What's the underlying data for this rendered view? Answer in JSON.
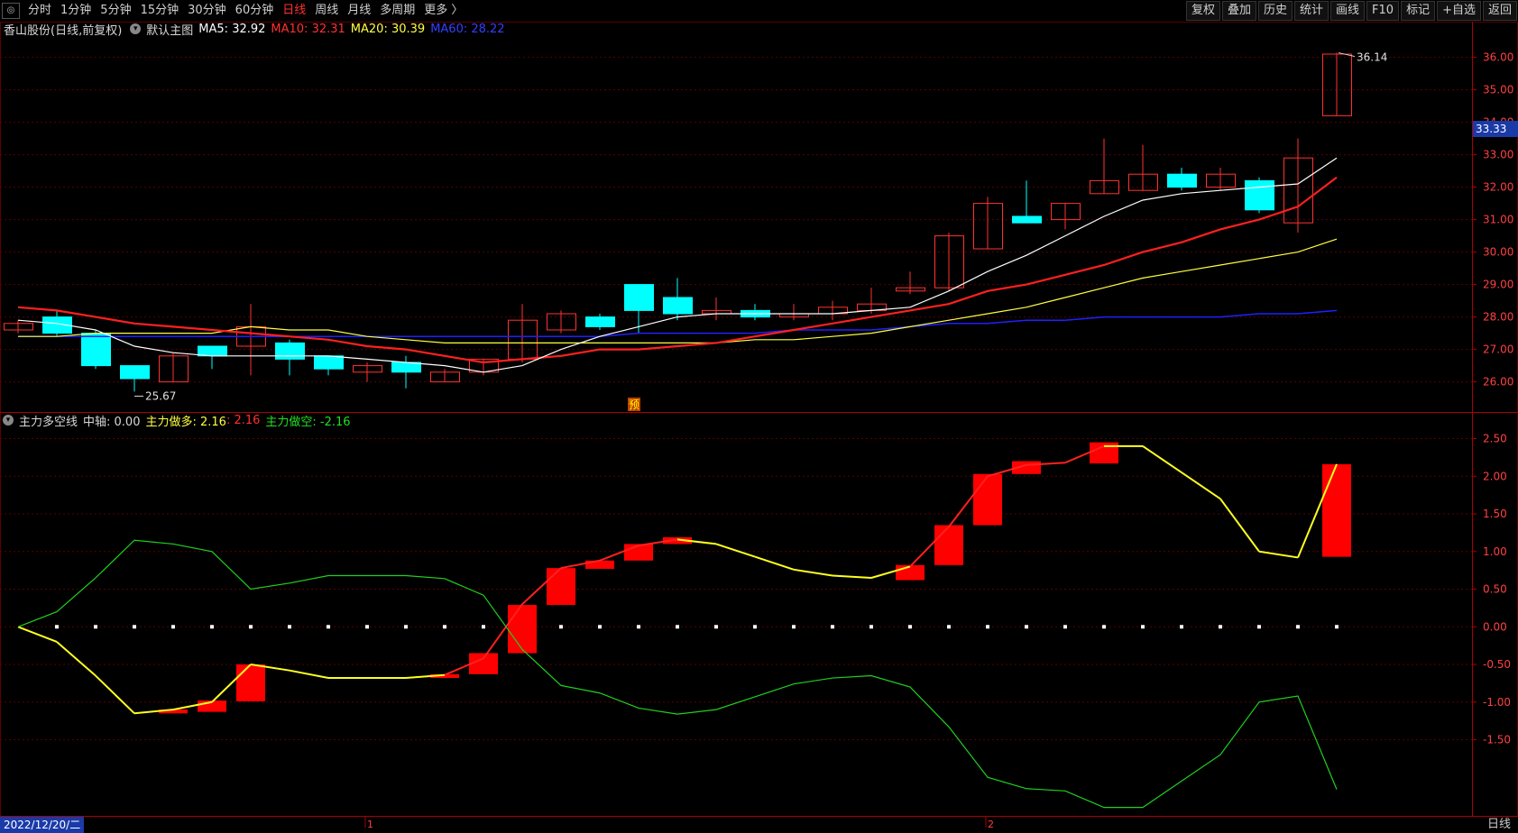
{
  "toolbar": {
    "periods": [
      {
        "label": "分时",
        "active": false
      },
      {
        "label": "1分钟",
        "active": false
      },
      {
        "label": "5分钟",
        "active": false
      },
      {
        "label": "15分钟",
        "active": false
      },
      {
        "label": "30分钟",
        "active": false
      },
      {
        "label": "60分钟",
        "active": false
      },
      {
        "label": "日线",
        "active": true
      },
      {
        "label": "周线",
        "active": false
      },
      {
        "label": "月线",
        "active": false
      },
      {
        "label": "多周期",
        "active": false
      },
      {
        "label": "更多 〉",
        "active": false
      }
    ],
    "right_buttons": [
      "复权",
      "叠加",
      "历史",
      "统计",
      "画线",
      "F10",
      "标记",
      "+自选",
      "返回"
    ]
  },
  "main_legend": {
    "stock": "香山股份(日线,前复权)",
    "chart_name": "默认主图",
    "ma5": "MA5: 32.92",
    "ma10": "MA10: 32.31",
    "ma20": "MA20: 30.39",
    "ma60": "MA60: 28.22"
  },
  "sub_legend": {
    "indicator": "主力多空线",
    "axis": "中轴: 0.00",
    "long_label": "主力做多: 2.16",
    "long_value": ": 2.16",
    "short_label": "主力做空: -2.16"
  },
  "annotations": {
    "high_label": "36.14",
    "low_label": "25.67",
    "pre_badge": "预",
    "current_price": "33.33",
    "month_marks": [
      "1",
      "2"
    ]
  },
  "status": {
    "date": "2022/12/20/二",
    "period": "日线"
  },
  "colors": {
    "up": "#ff3232",
    "down": "#00ffff",
    "ma5": "#ffffff",
    "ma10": "#ff2020",
    "ma20": "#ffff40",
    "ma60": "#2020ff",
    "grid": "#5a0000"
  },
  "chart_data": {
    "type": "candlestick",
    "price_axis": {
      "ticks": [
        26.0,
        27.0,
        28.0,
        29.0,
        30.0,
        31.0,
        32.0,
        33.0,
        34.0,
        35.0,
        36.0
      ],
      "ylim": [
        25.1,
        36.6
      ]
    },
    "candles": [
      {
        "o": 27.6,
        "h": 27.9,
        "l": 27.5,
        "c": 27.8
      },
      {
        "o": 28.0,
        "h": 28.2,
        "l": 27.4,
        "c": 27.5
      },
      {
        "o": 27.5,
        "h": 27.6,
        "l": 26.4,
        "c": 26.5
      },
      {
        "o": 26.5,
        "h": 26.5,
        "l": 25.7,
        "c": 26.1
      },
      {
        "o": 26.0,
        "h": 26.9,
        "l": 26.0,
        "c": 26.8
      },
      {
        "o": 27.1,
        "h": 27.1,
        "l": 26.4,
        "c": 26.8
      },
      {
        "o": 27.1,
        "h": 28.4,
        "l": 26.2,
        "c": 27.7
      },
      {
        "o": 27.2,
        "h": 27.3,
        "l": 26.2,
        "c": 26.7
      },
      {
        "o": 26.8,
        "h": 26.8,
        "l": 26.2,
        "c": 26.4
      },
      {
        "o": 26.3,
        "h": 26.6,
        "l": 26.0,
        "c": 26.5
      },
      {
        "o": 26.6,
        "h": 26.8,
        "l": 25.8,
        "c": 26.3
      },
      {
        "o": 26.0,
        "h": 26.4,
        "l": 26.0,
        "c": 26.3
      },
      {
        "o": 26.3,
        "h": 26.7,
        "l": 26.2,
        "c": 26.7
      },
      {
        "o": 26.7,
        "h": 28.4,
        "l": 26.6,
        "c": 27.9
      },
      {
        "o": 27.6,
        "h": 28.2,
        "l": 27.5,
        "c": 28.1
      },
      {
        "o": 28.0,
        "h": 28.1,
        "l": 27.6,
        "c": 27.7
      },
      {
        "o": 29.0,
        "h": 29.0,
        "l": 27.5,
        "c": 28.2
      },
      {
        "o": 28.6,
        "h": 29.2,
        "l": 27.9,
        "c": 28.1
      },
      {
        "o": 28.1,
        "h": 28.6,
        "l": 27.9,
        "c": 28.2
      },
      {
        "o": 28.2,
        "h": 28.4,
        "l": 27.9,
        "c": 28.0
      },
      {
        "o": 28.0,
        "h": 28.4,
        "l": 27.9,
        "c": 28.1
      },
      {
        "o": 28.1,
        "h": 28.5,
        "l": 27.9,
        "c": 28.3
      },
      {
        "o": 28.2,
        "h": 28.9,
        "l": 28.1,
        "c": 28.4
      },
      {
        "o": 28.8,
        "h": 29.4,
        "l": 28.7,
        "c": 28.9
      },
      {
        "o": 28.9,
        "h": 30.6,
        "l": 28.8,
        "c": 30.5
      },
      {
        "o": 30.1,
        "h": 31.7,
        "l": 30.1,
        "c": 31.5
      },
      {
        "o": 31.1,
        "h": 32.2,
        "l": 30.9,
        "c": 30.9
      },
      {
        "o": 31.0,
        "h": 31.5,
        "l": 30.7,
        "c": 31.5
      },
      {
        "o": 31.8,
        "h": 33.5,
        "l": 31.8,
        "c": 32.2
      },
      {
        "o": 31.9,
        "h": 33.3,
        "l": 31.9,
        "c": 32.4
      },
      {
        "o": 32.4,
        "h": 32.6,
        "l": 31.9,
        "c": 32.0
      },
      {
        "o": 32.0,
        "h": 32.6,
        "l": 31.9,
        "c": 32.4
      },
      {
        "o": 32.2,
        "h": 32.3,
        "l": 31.2,
        "c": 31.3
      },
      {
        "o": 30.9,
        "h": 33.5,
        "l": 30.6,
        "c": 32.9
      },
      {
        "o": 34.2,
        "h": 36.14,
        "l": 34.2,
        "c": 36.1
      }
    ],
    "ma5": [
      27.9,
      27.8,
      27.6,
      27.1,
      26.9,
      26.8,
      26.8,
      26.8,
      26.8,
      26.7,
      26.6,
      26.5,
      26.3,
      26.5,
      27.0,
      27.4,
      27.7,
      28.0,
      28.1,
      28.1,
      28.1,
      28.1,
      28.2,
      28.3,
      28.8,
      29.4,
      29.9,
      30.5,
      31.1,
      31.6,
      31.8,
      31.9,
      32.0,
      32.1,
      32.9
    ],
    "ma10": [
      28.3,
      28.2,
      28.0,
      27.8,
      27.7,
      27.6,
      27.5,
      27.4,
      27.3,
      27.1,
      27.0,
      26.8,
      26.6,
      26.7,
      26.8,
      27.0,
      27.0,
      27.1,
      27.2,
      27.4,
      27.6,
      27.8,
      28.0,
      28.2,
      28.4,
      28.8,
      29.0,
      29.3,
      29.6,
      30.0,
      30.3,
      30.7,
      31.0,
      31.4,
      32.3
    ],
    "ma20": [
      27.4,
      27.4,
      27.5,
      27.5,
      27.5,
      27.5,
      27.7,
      27.6,
      27.6,
      27.4,
      27.3,
      27.2,
      27.2,
      27.2,
      27.2,
      27.2,
      27.2,
      27.2,
      27.2,
      27.3,
      27.3,
      27.4,
      27.5,
      27.7,
      27.9,
      28.1,
      28.3,
      28.6,
      28.9,
      29.2,
      29.4,
      29.6,
      29.8,
      30.0,
      30.4
    ],
    "ma60": [
      27.4,
      27.4,
      27.4,
      27.4,
      27.4,
      27.4,
      27.4,
      27.4,
      27.4,
      27.4,
      27.4,
      27.4,
      27.4,
      27.4,
      27.4,
      27.4,
      27.5,
      27.5,
      27.5,
      27.5,
      27.6,
      27.6,
      27.6,
      27.7,
      27.8,
      27.8,
      27.9,
      27.9,
      28.0,
      28.0,
      28.0,
      28.0,
      28.1,
      28.1,
      28.2
    ],
    "indicator_axis": {
      "ticks": [
        2.5,
        2.0,
        1.5,
        1.0,
        0.5,
        0.0,
        -0.5,
        -1.0,
        -1.5
      ],
      "ylim": [
        -2.5,
        2.65
      ]
    },
    "main_long": [
      0.0,
      -0.2,
      -0.65,
      -1.15,
      -1.1,
      -1.0,
      -0.5,
      -0.58,
      -0.68,
      -0.68,
      -0.68,
      -0.64,
      -0.42,
      0.3,
      0.78,
      0.88,
      1.08,
      1.16,
      1.1,
      0.93,
      0.76,
      0.68,
      0.65,
      0.8,
      1.33,
      2.0,
      2.15,
      2.18,
      2.4,
      2.4,
      2.05,
      1.7,
      1.0,
      0.92,
      2.16
    ],
    "main_short": [
      0.0,
      0.2,
      0.65,
      1.15,
      1.1,
      1.0,
      0.5,
      0.58,
      0.68,
      0.68,
      0.68,
      0.64,
      0.42,
      -0.3,
      -0.78,
      -0.88,
      -1.08,
      -1.16,
      -1.1,
      -0.93,
      -0.76,
      -0.68,
      -0.65,
      -0.8,
      -1.33,
      -2.0,
      -2.15,
      -2.18,
      -2.4,
      -2.4,
      -2.05,
      -1.7,
      -1.0,
      -0.92,
      -2.16
    ],
    "red_bars": [
      {
        "i": 4,
        "top": -1.1,
        "bot": -1.15
      },
      {
        "i": 5,
        "top": -0.98,
        "bot": -1.13
      },
      {
        "i": 6,
        "top": -0.5,
        "bot": -0.99
      },
      {
        "i": 11,
        "top": -0.63,
        "bot": -0.68
      },
      {
        "i": 12,
        "top": -0.35,
        "bot": -0.63
      },
      {
        "i": 13,
        "top": 0.29,
        "bot": -0.35
      },
      {
        "i": 14,
        "top": 0.78,
        "bot": 0.29
      },
      {
        "i": 15,
        "top": 0.88,
        "bot": 0.77
      },
      {
        "i": 16,
        "top": 1.1,
        "bot": 0.88
      },
      {
        "i": 17,
        "top": 1.19,
        "bot": 1.1
      },
      {
        "i": 23,
        "top": 0.82,
        "bot": 0.62
      },
      {
        "i": 24,
        "top": 1.35,
        "bot": 0.82
      },
      {
        "i": 25,
        "top": 2.03,
        "bot": 1.35
      },
      {
        "i": 26,
        "top": 2.2,
        "bot": 2.03
      },
      {
        "i": 28,
        "top": 2.45,
        "bot": 2.17
      },
      {
        "i": 34,
        "top": 2.16,
        "bot": 0.93
      }
    ]
  }
}
